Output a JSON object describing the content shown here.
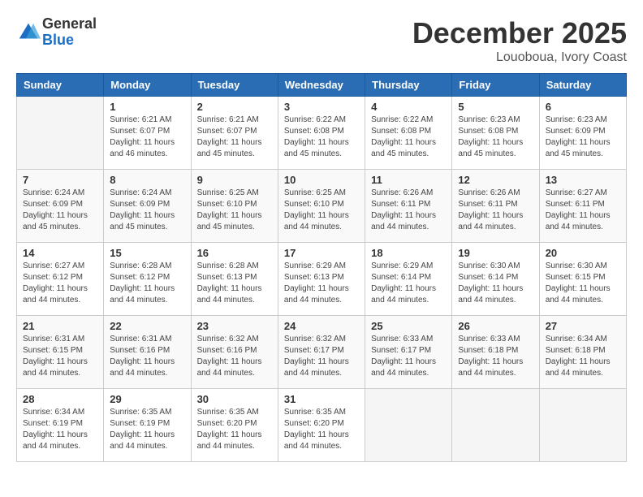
{
  "logo": {
    "general": "General",
    "blue": "Blue"
  },
  "header": {
    "month": "December 2025",
    "location": "Louoboua, Ivory Coast"
  },
  "weekdays": [
    "Sunday",
    "Monday",
    "Tuesday",
    "Wednesday",
    "Thursday",
    "Friday",
    "Saturday"
  ],
  "weeks": [
    [
      {
        "day": "",
        "info": ""
      },
      {
        "day": "1",
        "info": "Sunrise: 6:21 AM\nSunset: 6:07 PM\nDaylight: 11 hours\nand 46 minutes."
      },
      {
        "day": "2",
        "info": "Sunrise: 6:21 AM\nSunset: 6:07 PM\nDaylight: 11 hours\nand 45 minutes."
      },
      {
        "day": "3",
        "info": "Sunrise: 6:22 AM\nSunset: 6:08 PM\nDaylight: 11 hours\nand 45 minutes."
      },
      {
        "day": "4",
        "info": "Sunrise: 6:22 AM\nSunset: 6:08 PM\nDaylight: 11 hours\nand 45 minutes."
      },
      {
        "day": "5",
        "info": "Sunrise: 6:23 AM\nSunset: 6:08 PM\nDaylight: 11 hours\nand 45 minutes."
      },
      {
        "day": "6",
        "info": "Sunrise: 6:23 AM\nSunset: 6:09 PM\nDaylight: 11 hours\nand 45 minutes."
      }
    ],
    [
      {
        "day": "7",
        "info": "Sunrise: 6:24 AM\nSunset: 6:09 PM\nDaylight: 11 hours\nand 45 minutes."
      },
      {
        "day": "8",
        "info": "Sunrise: 6:24 AM\nSunset: 6:09 PM\nDaylight: 11 hours\nand 45 minutes."
      },
      {
        "day": "9",
        "info": "Sunrise: 6:25 AM\nSunset: 6:10 PM\nDaylight: 11 hours\nand 45 minutes."
      },
      {
        "day": "10",
        "info": "Sunrise: 6:25 AM\nSunset: 6:10 PM\nDaylight: 11 hours\nand 44 minutes."
      },
      {
        "day": "11",
        "info": "Sunrise: 6:26 AM\nSunset: 6:11 PM\nDaylight: 11 hours\nand 44 minutes."
      },
      {
        "day": "12",
        "info": "Sunrise: 6:26 AM\nSunset: 6:11 PM\nDaylight: 11 hours\nand 44 minutes."
      },
      {
        "day": "13",
        "info": "Sunrise: 6:27 AM\nSunset: 6:11 PM\nDaylight: 11 hours\nand 44 minutes."
      }
    ],
    [
      {
        "day": "14",
        "info": "Sunrise: 6:27 AM\nSunset: 6:12 PM\nDaylight: 11 hours\nand 44 minutes."
      },
      {
        "day": "15",
        "info": "Sunrise: 6:28 AM\nSunset: 6:12 PM\nDaylight: 11 hours\nand 44 minutes."
      },
      {
        "day": "16",
        "info": "Sunrise: 6:28 AM\nSunset: 6:13 PM\nDaylight: 11 hours\nand 44 minutes."
      },
      {
        "day": "17",
        "info": "Sunrise: 6:29 AM\nSunset: 6:13 PM\nDaylight: 11 hours\nand 44 minutes."
      },
      {
        "day": "18",
        "info": "Sunrise: 6:29 AM\nSunset: 6:14 PM\nDaylight: 11 hours\nand 44 minutes."
      },
      {
        "day": "19",
        "info": "Sunrise: 6:30 AM\nSunset: 6:14 PM\nDaylight: 11 hours\nand 44 minutes."
      },
      {
        "day": "20",
        "info": "Sunrise: 6:30 AM\nSunset: 6:15 PM\nDaylight: 11 hours\nand 44 minutes."
      }
    ],
    [
      {
        "day": "21",
        "info": "Sunrise: 6:31 AM\nSunset: 6:15 PM\nDaylight: 11 hours\nand 44 minutes."
      },
      {
        "day": "22",
        "info": "Sunrise: 6:31 AM\nSunset: 6:16 PM\nDaylight: 11 hours\nand 44 minutes."
      },
      {
        "day": "23",
        "info": "Sunrise: 6:32 AM\nSunset: 6:16 PM\nDaylight: 11 hours\nand 44 minutes."
      },
      {
        "day": "24",
        "info": "Sunrise: 6:32 AM\nSunset: 6:17 PM\nDaylight: 11 hours\nand 44 minutes."
      },
      {
        "day": "25",
        "info": "Sunrise: 6:33 AM\nSunset: 6:17 PM\nDaylight: 11 hours\nand 44 minutes."
      },
      {
        "day": "26",
        "info": "Sunrise: 6:33 AM\nSunset: 6:18 PM\nDaylight: 11 hours\nand 44 minutes."
      },
      {
        "day": "27",
        "info": "Sunrise: 6:34 AM\nSunset: 6:18 PM\nDaylight: 11 hours\nand 44 minutes."
      }
    ],
    [
      {
        "day": "28",
        "info": "Sunrise: 6:34 AM\nSunset: 6:19 PM\nDaylight: 11 hours\nand 44 minutes."
      },
      {
        "day": "29",
        "info": "Sunrise: 6:35 AM\nSunset: 6:19 PM\nDaylight: 11 hours\nand 44 minutes."
      },
      {
        "day": "30",
        "info": "Sunrise: 6:35 AM\nSunset: 6:20 PM\nDaylight: 11 hours\nand 44 minutes."
      },
      {
        "day": "31",
        "info": "Sunrise: 6:35 AM\nSunset: 6:20 PM\nDaylight: 11 hours\nand 44 minutes."
      },
      {
        "day": "",
        "info": ""
      },
      {
        "day": "",
        "info": ""
      },
      {
        "day": "",
        "info": ""
      }
    ]
  ]
}
